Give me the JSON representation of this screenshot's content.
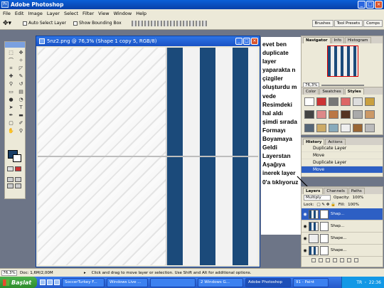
{
  "app": {
    "title": "Adobe Photoshop"
  },
  "menu": [
    "File",
    "Edit",
    "Image",
    "Layer",
    "Select",
    "Filter",
    "View",
    "Window",
    "Help"
  ],
  "options": {
    "auto_select_label": "Auto Select Layer",
    "bounding_box_label": "Show Bounding Box",
    "wells": [
      "Brushes",
      "Tool Presets",
      "Comps"
    ]
  },
  "document": {
    "title": "5nz2.png @ 76,3% (Shape 1 copy 5, RGB/8)"
  },
  "note": {
    "text": "evet ben duplicate layer yaparakta n çizgiler oluşturdu m vede Resimdeki hal aldı şimdi sırada Formayı Boyamaya Geldi Layerstan Aşağıya inerek layer 0'a tıklıyoruz"
  },
  "navigator": {
    "tabs": [
      "Navigator",
      "Info",
      "Histogram"
    ],
    "zoom": "76,3%"
  },
  "styles": {
    "tabs": [
      "Color",
      "Swatches",
      "Styles"
    ]
  },
  "history": {
    "tabs": [
      "History",
      "Actions"
    ],
    "items": [
      "Duplicate Layer",
      "Move",
      "Duplicate Layer",
      "Move"
    ]
  },
  "layers": {
    "tabs": [
      "Layers",
      "Channels",
      "Paths"
    ],
    "blend_mode": "Multiply",
    "opacity_label": "Opacity:",
    "opacity": "100%",
    "lock_label": "Lock:",
    "fill_label": "Fill:",
    "fill": "100%",
    "rows": [
      "Shap...",
      "Shap...",
      "Shape...",
      "Shape..."
    ]
  },
  "status": {
    "zoom": "76,3%",
    "doc": "Doc: 1,6M/2,00M",
    "hint": "Click and drag to move layer or selection.  Use Shift and Alt for additional options."
  },
  "taskbar": {
    "start": "Başlat",
    "tasks": [
      "SoccerTurkey F...",
      "Windows Live ...",
      "",
      "2 Windows G...",
      "Adobe Photoshop",
      "91 - Paint"
    ],
    "lang": "TR",
    "clock": "22:36"
  },
  "colors": {
    "stripe": "#1b4a7a",
    "xp_blue": "#2459c9",
    "selection": "#2d5fc4"
  }
}
